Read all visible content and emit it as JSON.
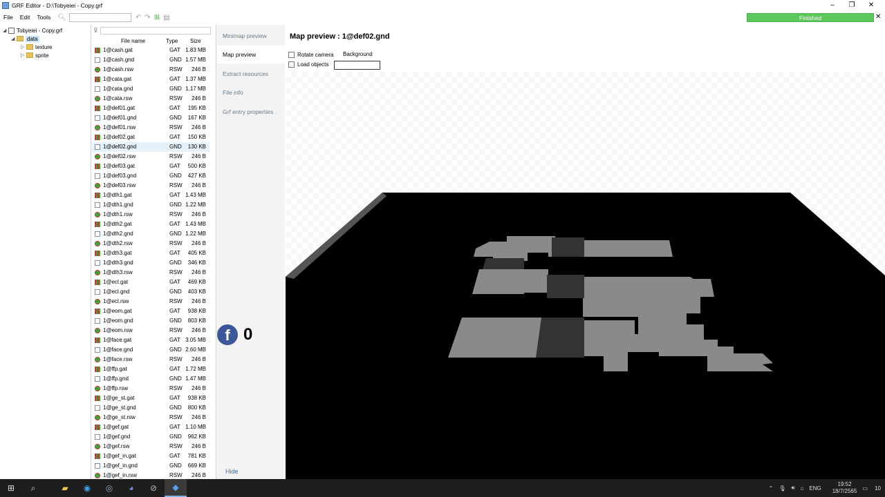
{
  "window": {
    "title": "GRF Editor - D:\\Tobyeiei - Copy.grf"
  },
  "menu": {
    "file": "File",
    "edit": "Edit",
    "tools": "Tools"
  },
  "progress": {
    "label": "Finished",
    "fraction": 1.0
  },
  "tree": {
    "root": "Tobyeiei - Copy.grf",
    "data": "data",
    "texture": "texture",
    "sprite": "sprite"
  },
  "list": {
    "headers": {
      "name": "File name",
      "type": "Type",
      "size": "Size"
    },
    "rows": [
      {
        "name": "1@cash.gat",
        "type": "GAT",
        "size": "1.83 MB"
      },
      {
        "name": "1@cash.gnd",
        "type": "GND",
        "size": "1.57 MB"
      },
      {
        "name": "1@cash.rsw",
        "type": "RSW",
        "size": "246 B"
      },
      {
        "name": "1@cata.gat",
        "type": "GAT",
        "size": "1.37 MB"
      },
      {
        "name": "1@cata.gnd",
        "type": "GND",
        "size": "1.17 MB"
      },
      {
        "name": "1@cata.rsw",
        "type": "RSW",
        "size": "246 B"
      },
      {
        "name": "1@def01.gat",
        "type": "GAT",
        "size": "195 KB"
      },
      {
        "name": "1@def01.gnd",
        "type": "GND",
        "size": "167 KB"
      },
      {
        "name": "1@def01.rsw",
        "type": "RSW",
        "size": "246 B"
      },
      {
        "name": "1@def02.gat",
        "type": "GAT",
        "size": "150 KB"
      },
      {
        "name": "1@def02.gnd",
        "type": "GND",
        "size": "130 KB"
      },
      {
        "name": "1@def02.rsw",
        "type": "RSW",
        "size": "246 B"
      },
      {
        "name": "1@def03.gat",
        "type": "GAT",
        "size": "500 KB"
      },
      {
        "name": "1@def03.gnd",
        "type": "GND",
        "size": "427 KB"
      },
      {
        "name": "1@def03.rsw",
        "type": "RSW",
        "size": "246 B"
      },
      {
        "name": "1@dth1.gat",
        "type": "GAT",
        "size": "1.43 MB"
      },
      {
        "name": "1@dth1.gnd",
        "type": "GND",
        "size": "1.22 MB"
      },
      {
        "name": "1@dth1.rsw",
        "type": "RSW",
        "size": "246 B"
      },
      {
        "name": "1@dth2.gat",
        "type": "GAT",
        "size": "1.43 MB"
      },
      {
        "name": "1@dth2.gnd",
        "type": "GND",
        "size": "1.22 MB"
      },
      {
        "name": "1@dth2.rsw",
        "type": "RSW",
        "size": "246 B"
      },
      {
        "name": "1@dth3.gat",
        "type": "GAT",
        "size": "405 KB"
      },
      {
        "name": "1@dth3.gnd",
        "type": "GND",
        "size": "346 KB"
      },
      {
        "name": "1@dth3.rsw",
        "type": "RSW",
        "size": "246 B"
      },
      {
        "name": "1@ecl.gat",
        "type": "GAT",
        "size": "469 KB"
      },
      {
        "name": "1@ecl.gnd",
        "type": "GND",
        "size": "403 KB"
      },
      {
        "name": "1@ecl.rsw",
        "type": "RSW",
        "size": "246 B"
      },
      {
        "name": "1@eom.gat",
        "type": "GAT",
        "size": "938 KB"
      },
      {
        "name": "1@eom.gnd",
        "type": "GND",
        "size": "803 KB"
      },
      {
        "name": "1@eom.rsw",
        "type": "RSW",
        "size": "246 B"
      },
      {
        "name": "1@face.gat",
        "type": "GAT",
        "size": "3.05 MB"
      },
      {
        "name": "1@face.gnd",
        "type": "GND",
        "size": "2.60 MB"
      },
      {
        "name": "1@face.rsw",
        "type": "RSW",
        "size": "246 B"
      },
      {
        "name": "1@ffp.gat",
        "type": "GAT",
        "size": "1.72 MB"
      },
      {
        "name": "1@ffp.gnd",
        "type": "GND",
        "size": "1.47 MB"
      },
      {
        "name": "1@ffp.rsw",
        "type": "RSW",
        "size": "246 B"
      },
      {
        "name": "1@ge_st.gat",
        "type": "GAT",
        "size": "938 KB"
      },
      {
        "name": "1@ge_st.gnd",
        "type": "GND",
        "size": "800 KB"
      },
      {
        "name": "1@ge_st.rsw",
        "type": "RSW",
        "size": "246 B"
      },
      {
        "name": "1@gef.gat",
        "type": "GAT",
        "size": "1.10 MB"
      },
      {
        "name": "1@gef.gnd",
        "type": "GND",
        "size": "962 KB"
      },
      {
        "name": "1@gef.rsw",
        "type": "RSW",
        "size": "246 B"
      },
      {
        "name": "1@gef_in.gat",
        "type": "GAT",
        "size": "781 KB"
      },
      {
        "name": "1@gef_in.gnd",
        "type": "GND",
        "size": "669 KB"
      },
      {
        "name": "1@gef_in.rsw",
        "type": "RSW",
        "size": "246 B"
      }
    ]
  },
  "side": {
    "tabs": [
      "Minimap preview",
      "Map preview",
      "Extract resources",
      "File info",
      "Grf entry properties"
    ],
    "hide": "Hide"
  },
  "social": {
    "count": "0"
  },
  "preview": {
    "title": "Map preview : 1@def02.gnd",
    "rotate": "Rotate camera",
    "load": "Load objects",
    "background": "Background"
  },
  "taskbar": {
    "lang": "ENG",
    "time": "19:52",
    "date": "18/7/2565",
    "notif": "10"
  }
}
